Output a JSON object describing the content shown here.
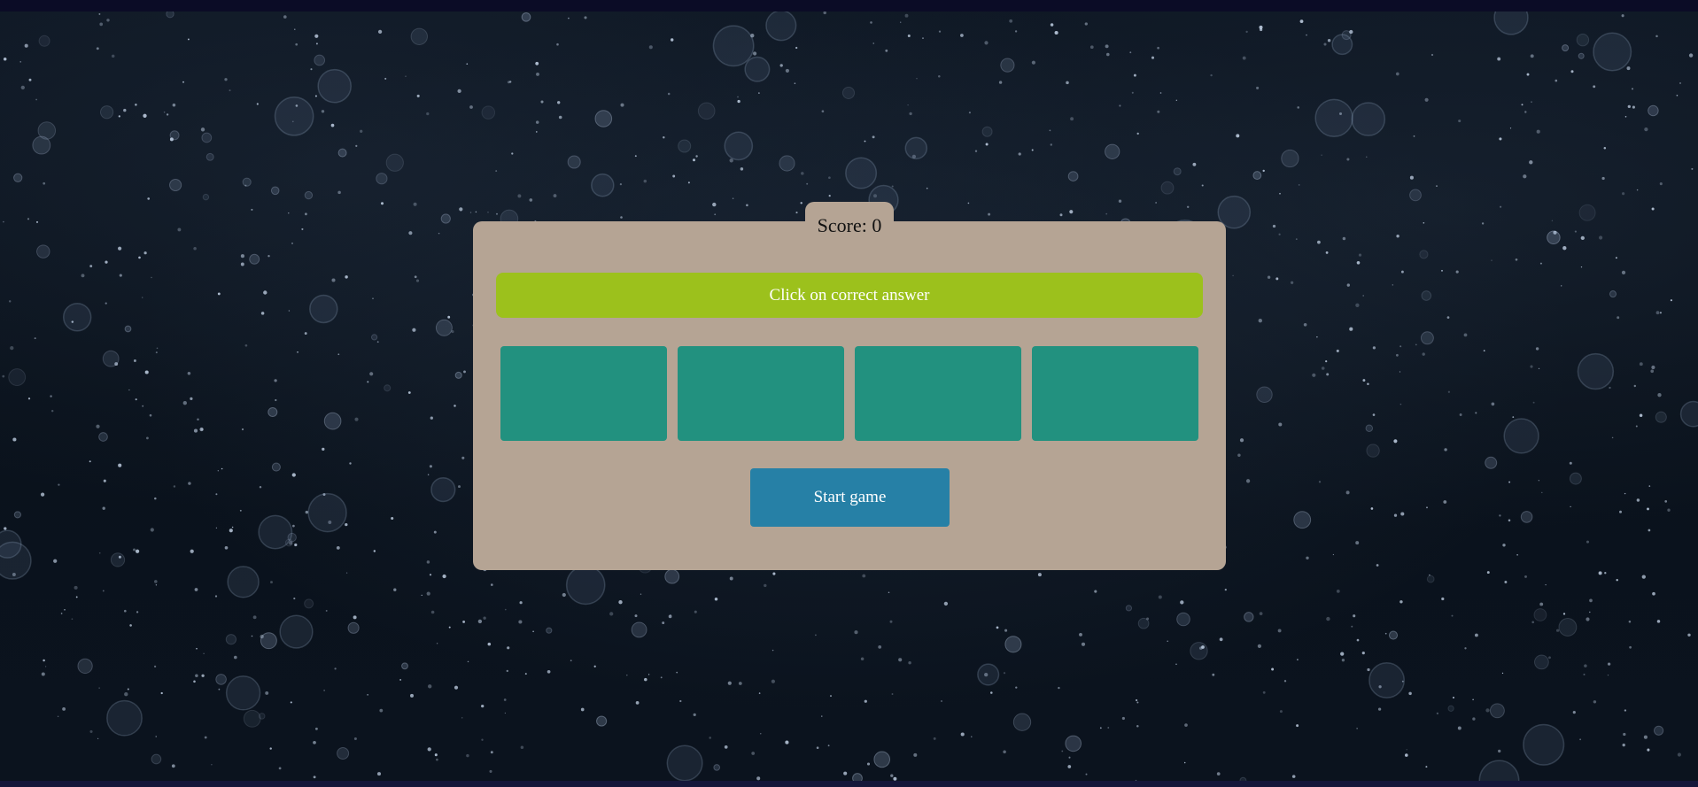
{
  "score": {
    "label": "Score: 0",
    "value": 0
  },
  "instruction": "Click on correct answer",
  "answers": [
    "",
    "",
    "",
    ""
  ],
  "start_button": "Start game",
  "colors": {
    "panel": "#b5a494",
    "instruction_bar": "#9cc11c",
    "answer_box": "#22917f",
    "start_button": "#2680a6",
    "background": "#0a111c"
  },
  "background_image": "underwater-bubbles"
}
